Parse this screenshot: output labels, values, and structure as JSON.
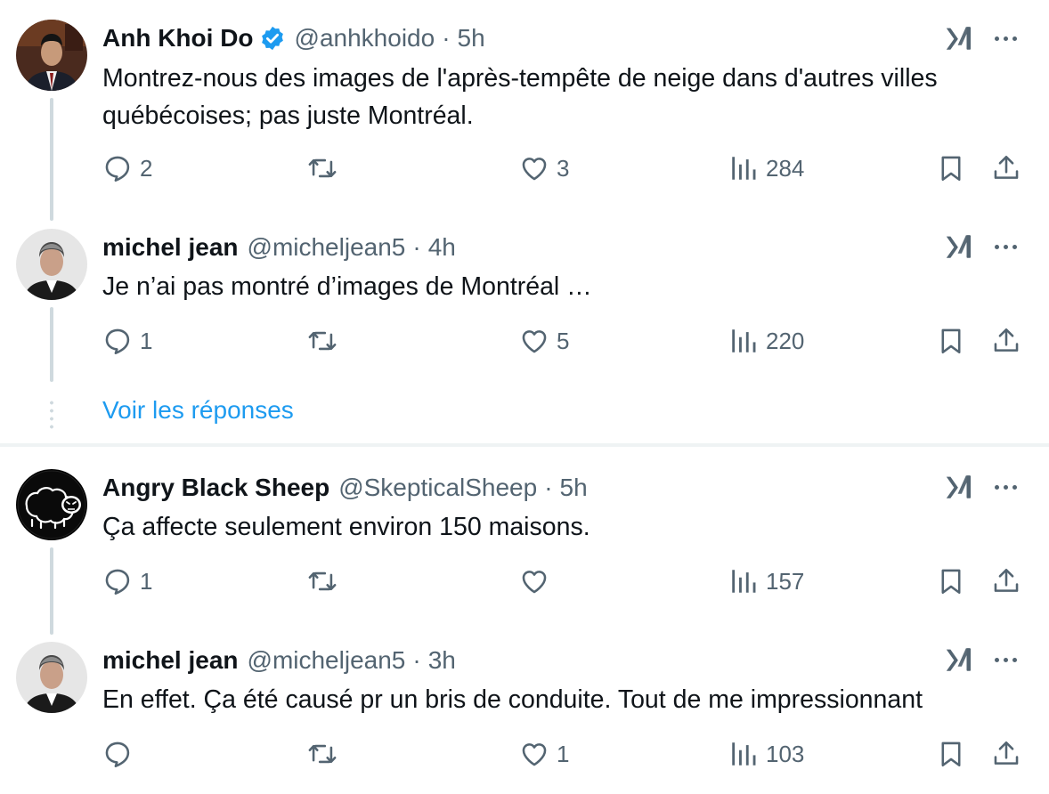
{
  "tweets": [
    {
      "name": "Anh Khoi Do",
      "verified": true,
      "handle": "@anhkhoido",
      "time": "5h",
      "text": "Montrez-nous des images de l'après-tempête de neige dans d'autres villes québécoises; pas juste Montréal.",
      "replies": "2",
      "retweets": "",
      "likes": "3",
      "views": "284"
    },
    {
      "name": "michel jean",
      "verified": false,
      "handle": "@micheljean5",
      "time": "4h",
      "text": "Je n’ai pas montré d’images de Montréal …",
      "replies": "1",
      "retweets": "",
      "likes": "5",
      "views": "220"
    },
    {
      "name": "Angry Black Sheep",
      "verified": false,
      "handle": "@SkepticalSheep",
      "time": "5h",
      "text": "Ça affecte seulement environ 150 maisons.",
      "replies": "1",
      "retweets": "",
      "likes": "",
      "views": "157"
    },
    {
      "name": "michel jean",
      "verified": false,
      "handle": "@micheljean5",
      "time": "3h",
      "text": "En effet. Ça été causé pr un bris de conduite. Tout de me impressionnant",
      "replies": "",
      "retweets": "",
      "likes": "1",
      "views": "103"
    }
  ],
  "show_replies_label": "Voir les réponses",
  "separator_dot": "·",
  "icons": {
    "reply": "reply-icon",
    "retweet": "retweet-icon",
    "like": "heart-icon",
    "views": "views-icon",
    "bookmark": "bookmark-icon",
    "share": "share-icon",
    "grok": "grok-icon",
    "more": "more-icon",
    "verified": "verified-badge-icon"
  },
  "colors": {
    "accent": "#1d9bf0",
    "text": "#0f1419",
    "muted": "#536471",
    "thread_line": "#cfd9de"
  }
}
